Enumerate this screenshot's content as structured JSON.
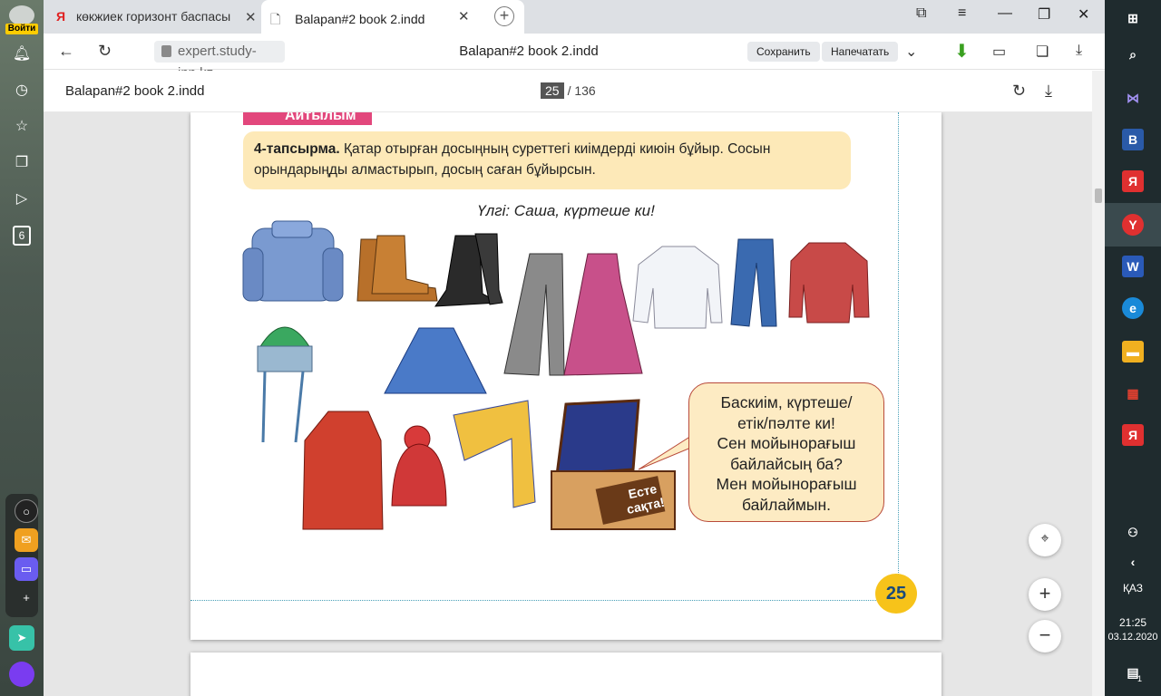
{
  "left_sidebar": {
    "login_label": "Войти",
    "badge_count": "6"
  },
  "tabs": [
    {
      "label": "көкжиек горизонт баспасы"
    },
    {
      "label": "Balapan#2 book 2.indd"
    }
  ],
  "address_bar": {
    "url": "expert.study-inn.kz",
    "page_title": "Balapan#2 book 2.indd",
    "save_label": "Сохранить",
    "print_label": "Напечатать"
  },
  "pdf_toolbar": {
    "title": "Balapan#2 book 2.indd",
    "current_page": "25",
    "total_pages": "/ 136"
  },
  "page": {
    "section_title": "Айтылым",
    "task_number": "4-тапсырма.",
    "task_text": " Қатар отырған досыңның суреттегі киімдерді киюін бұйыр. Сосын орындарыңды алмастырып, досың саған бұйырсын.",
    "sample": "Үлгі: Саша, күртеше ки!",
    "chest_label_1": "Есте",
    "chest_label_2": "сақта!",
    "bubble_lines": [
      "Баскиім, күртеше/",
      "етік/пәлте ки!",
      "Сен мойынорағыш",
      "байлайсың ба?",
      "Мен мойынорағыш",
      "байлаймын."
    ],
    "page_number": "25"
  },
  "taskbar": {
    "language": "ҚАЗ",
    "time": "21:25",
    "date": "03.12.2020",
    "notification_count": "1"
  }
}
